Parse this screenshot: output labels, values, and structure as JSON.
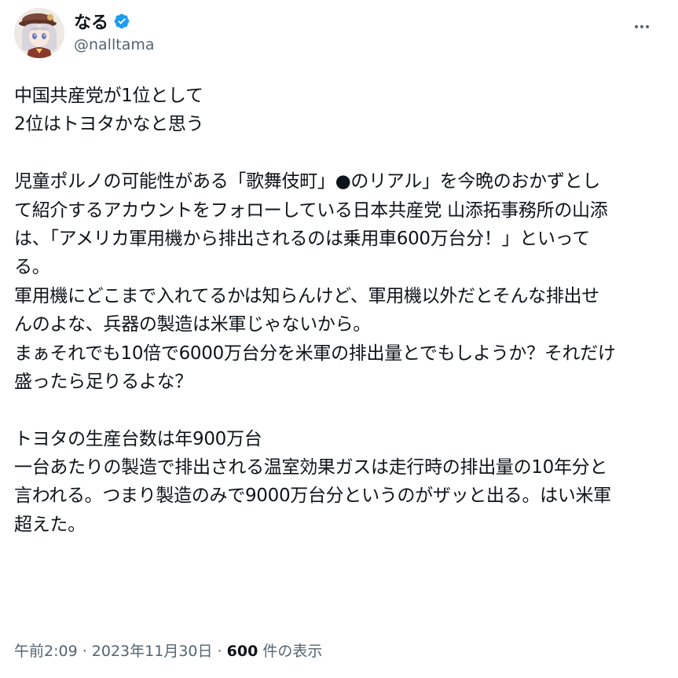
{
  "author": {
    "display_name": "なる",
    "handle": "@nalltama",
    "verified": true,
    "avatar_icon": "avatar-anime-girl-icon"
  },
  "more_icon": "more-horizontal-icon",
  "body_lines": [
    "中国共産党が1位として",
    "2位はトヨタかなと思う",
    "",
    "児童ポルノの可能性がある「歌舞伎町」●のリアル」を今晩のおかずとし",
    "て紹介するアカウントをフォローしている日本共産党 山添拓事務所の山添",
    "は、「アメリカ軍用機から排出されるのは乗用車600万台分！」といって",
    "る。",
    "軍用機にどこまで入れてるかは知らんけど、軍用機以外だとそんな排出せ",
    "んのよな、兵器の製造は米軍じゃないから。",
    "まぁそれでも10倍で6000万台分を米軍の排出量とでもしようか？それだけ",
    "盛ったら足りるよな？",
    "",
    "トヨタの生産台数は年900万台",
    "一台あたりの製造で排出される温室効果ガスは走行時の排出量の10年分と",
    "言われる。つまり製造のみで9000万台分というのがザッと出る。はい米軍",
    "超えた。"
  ],
  "meta": {
    "time": "午前2:09",
    "separator": " · ",
    "date": "2023年11月30日",
    "views_count": "600",
    "views_label": " 件の表示"
  },
  "colors": {
    "text": "#0f1419",
    "secondary": "#536471",
    "verified": "#1d9bf0"
  }
}
